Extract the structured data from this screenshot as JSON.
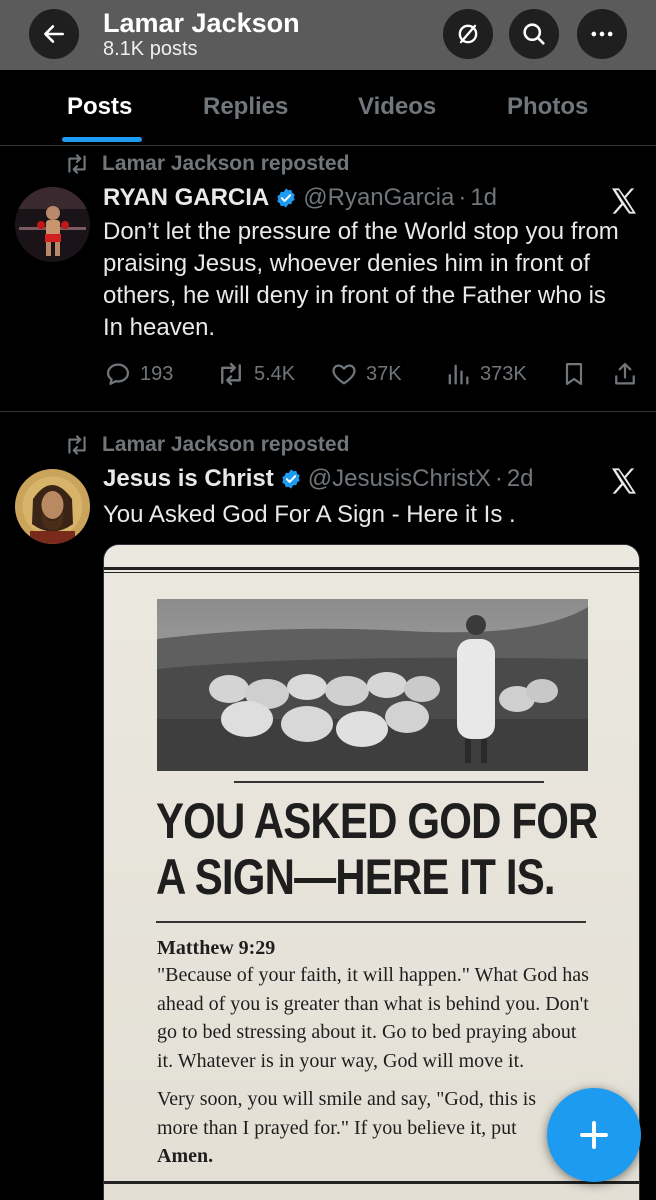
{
  "header": {
    "title": "Lamar Jackson",
    "subtitle": "8.1K posts",
    "back_icon": "arrow-left-icon",
    "mute_icon": "bell-off-icon",
    "search_icon": "search-icon",
    "more_icon": "more-icon"
  },
  "tabs": [
    {
      "label": "Posts",
      "active": true
    },
    {
      "label": "Replies",
      "active": false
    },
    {
      "label": "Videos",
      "active": false
    },
    {
      "label": "Photos",
      "active": false
    }
  ],
  "posts": [
    {
      "repost_label": "Lamar Jackson reposted",
      "author_name": "RYAN GARCIA",
      "handle": "@RyanGarcia",
      "separator": "·",
      "time": "1d",
      "text": "Don’t let the pressure of the World stop you from praising Jesus, whoever denies him in front of others, he will deny in front of the Father who is In heaven.",
      "stats": {
        "replies": "193",
        "reposts": "5.4K",
        "likes": "37K",
        "views": "373K"
      }
    },
    {
      "repost_label": "Lamar Jackson reposted",
      "author_name": "Jesus is Christ",
      "handle": "@JesusisChristX",
      "separator": "·",
      "time": "2d",
      "text": "You Asked God For A Sign - Here it Is .",
      "media": {
        "headline_line1": "YOU ASKED GOD FOR",
        "headline_line2": "A SIGN—HERE IT IS.",
        "verse_ref": "Matthew 9:29",
        "verse_text": "\"Because of your faith, it will happen.\" What God has ahead of you is greater than what is behind you. Don't go to bed stressing about it. Go to bed praying about it. Whatever is in your way, God will move it.",
        "closing_text": "Very soon, you will smile and say, \"God, this is more than I prayed for.\" If you believe it, put",
        "closing_bold": "Amen."
      }
    }
  ],
  "colors": {
    "accent": "#1d9bf0",
    "background": "#000000",
    "muted_text": "#71767b",
    "verified_badge": "#1d9bf0"
  },
  "fab": {
    "icon": "plus-icon"
  }
}
